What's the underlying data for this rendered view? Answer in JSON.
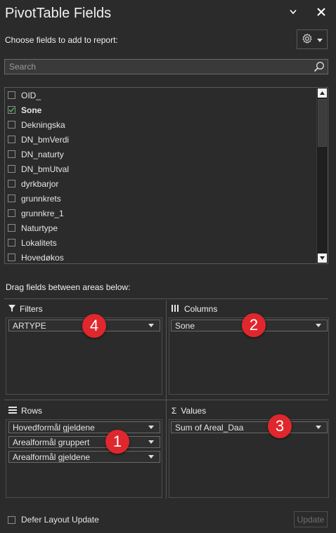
{
  "panel": {
    "title": "PivotTable Fields",
    "choose_label": "Choose fields to add to report:",
    "icons": {
      "dropdown": "chevron-down-icon",
      "close": "close-icon",
      "settings": "gear-icon",
      "search": "search-icon"
    }
  },
  "search": {
    "placeholder": "Search",
    "value": ""
  },
  "fields": [
    {
      "label": "OID_",
      "checked": false
    },
    {
      "label": "Sone",
      "checked": true
    },
    {
      "label": "Dekningska",
      "checked": false
    },
    {
      "label": "DN_bmVerdi",
      "checked": false
    },
    {
      "label": "DN_naturty",
      "checked": false
    },
    {
      "label": "DN_bmUtval",
      "checked": false
    },
    {
      "label": "dyrkbarjor",
      "checked": false
    },
    {
      "label": "grunnkrets",
      "checked": false
    },
    {
      "label": "grunnkre_1",
      "checked": false
    },
    {
      "label": "Naturtype",
      "checked": false
    },
    {
      "label": "Lokalitets",
      "checked": false
    },
    {
      "label": "Hovedøkos",
      "checked": false
    }
  ],
  "drag_label": "Drag fields between areas below:",
  "areas": {
    "filters": {
      "title": "Filters",
      "items": [
        "ARTYPE"
      ],
      "badge": "4"
    },
    "columns": {
      "title": "Columns",
      "items": [
        "Sone"
      ],
      "badge": "2"
    },
    "rows": {
      "title": "Rows",
      "items": [
        "Hovedformål gjeldene",
        "Arealformål gruppert",
        "Arealformål gjeldene"
      ],
      "badge": "1"
    },
    "values": {
      "title": "Values",
      "items": [
        "Sum of Areal_Daa"
      ],
      "badge": "3"
    }
  },
  "footer": {
    "defer_label": "Defer Layout Update",
    "defer_checked": false,
    "update_label": "Update"
  },
  "colors": {
    "background": "#2b2b2b",
    "badge": "#e0272d",
    "check_accent": "#3fb34f"
  }
}
